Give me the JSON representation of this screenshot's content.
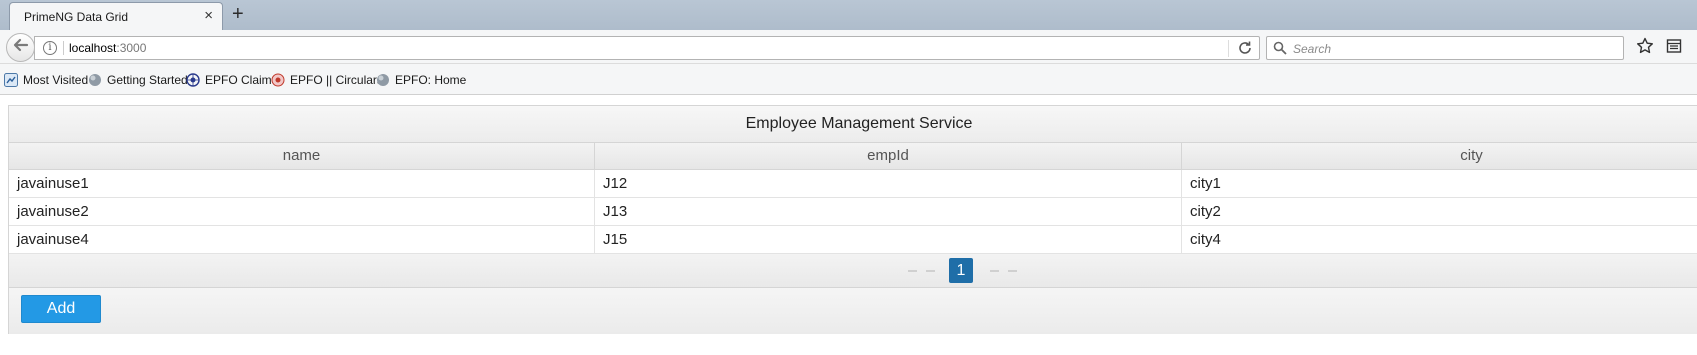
{
  "browser": {
    "tab_title": "PrimeNG Data Grid",
    "close_glyph": "×",
    "new_tab_glyph": "+",
    "url_host": "localhost",
    "url_port": ":3000",
    "search_placeholder": "Search",
    "info_glyph": "i"
  },
  "bookmarks": [
    {
      "label": "Most Visited",
      "icon": "most-visited-icon"
    },
    {
      "label": "Getting Started",
      "icon": "globe-icon"
    },
    {
      "label": "EPFO Claim",
      "icon": "epfo-logo-icon"
    },
    {
      "label": "EPFO || Circulars",
      "icon": "epfo-circulars-icon"
    },
    {
      "label": "EPFO: Home",
      "icon": "globe-icon"
    }
  ],
  "grid": {
    "caption": "Employee Management Service",
    "columns": [
      "name",
      "empId",
      "city"
    ],
    "rows": [
      [
        "javainuse1",
        "J12",
        "city1"
      ],
      [
        "javainuse2",
        "J13",
        "city2"
      ],
      [
        "javainuse4",
        "J15",
        "city4"
      ]
    ],
    "current_page": "1",
    "add_label": "Add"
  },
  "colors": {
    "accent": "#2399e5",
    "page_active": "#1f6ea8"
  }
}
